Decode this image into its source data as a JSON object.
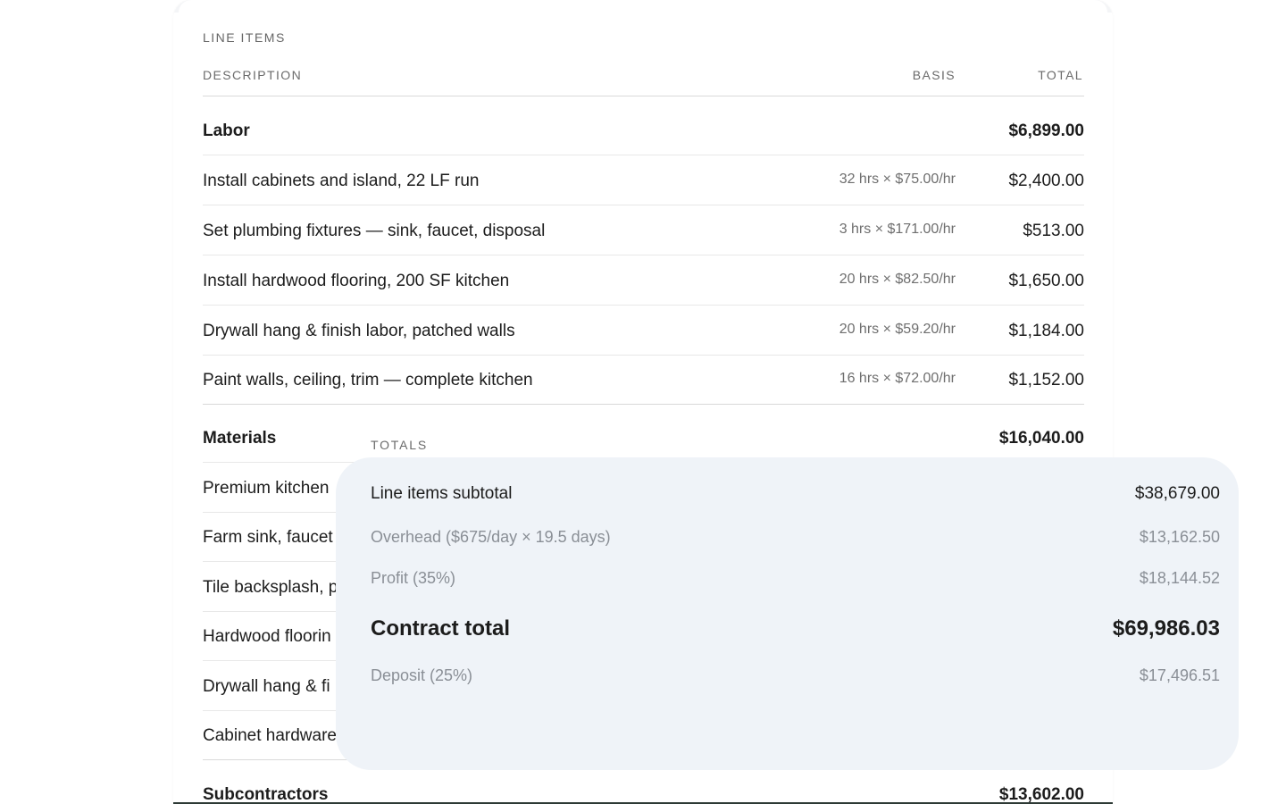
{
  "line_items": {
    "section_label": "LINE ITEMS",
    "columns": {
      "description": "DESCRIPTION",
      "basis": "BASIS",
      "total": "TOTAL"
    },
    "labor": {
      "group_name": "Labor",
      "group_total": "$6,899.00",
      "items": [
        {
          "description": "Install cabinets and island, 22 LF run",
          "basis": "32 hrs × $75.00/hr",
          "total": "$2,400.00"
        },
        {
          "description": "Set plumbing fixtures — sink, faucet, disposal",
          "basis": "3 hrs × $171.00/hr",
          "total": "$513.00"
        },
        {
          "description": "Install hardwood flooring, 200 SF kitchen",
          "basis": "20 hrs × $82.50/hr",
          "total": "$1,650.00"
        },
        {
          "description": "Drywall hang & finish labor, patched walls",
          "basis": "20 hrs × $59.20/hr",
          "total": "$1,184.00"
        },
        {
          "description": "Paint walls, ceiling, trim — complete kitchen",
          "basis": "16 hrs × $72.00/hr",
          "total": "$1,152.00"
        }
      ]
    },
    "materials": {
      "group_name": "Materials",
      "group_total": "$16,040.00",
      "items": [
        {
          "description": "Premium kitchen"
        },
        {
          "description": "Farm sink, faucet"
        },
        {
          "description": "Tile backsplash, p"
        },
        {
          "description": "Hardwood floorin"
        },
        {
          "description": "Drywall hang & fi"
        },
        {
          "description": "Cabinet hardware"
        }
      ]
    },
    "subcontractors": {
      "group_name": "Subcontractors",
      "group_total": "$13,602.00"
    }
  },
  "totals": {
    "section_label": "TOTALS",
    "subtotal_label": "Line items subtotal",
    "subtotal_value": "$38,679.00",
    "overhead_label": "Overhead ($675/day × 19.5 days)",
    "overhead_value": "$13,162.50",
    "profit_label": "Profit (35%)",
    "profit_value": "$18,144.52",
    "contract_label": "Contract total",
    "contract_value": "$69,986.03",
    "deposit_label": "Deposit (25%)",
    "deposit_value": "$17,496.51"
  }
}
